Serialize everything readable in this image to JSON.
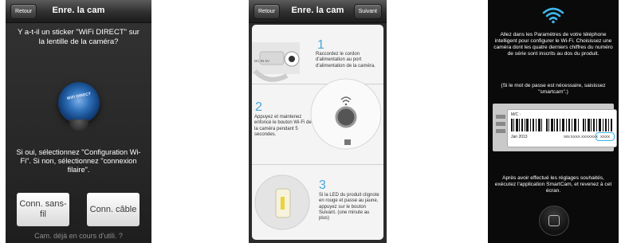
{
  "screen1": {
    "back_label": "Retour",
    "title": "Enre. la cam",
    "question": "Y a-t-il un sticker \"WiFi DIRECT\" sur la lentille de la caméra?",
    "lens_text": "WiFi DIRECT",
    "answer": "Si oui, sélectionnez \"Configuration Wi-Fi\". Si non, sélectionnez \"connexion filaire\".",
    "btn_wifi": "Conn. sans-fil",
    "btn_wired": "Conn. câble",
    "bottom_link": "Cam. déjà en cours d'utili. ?"
  },
  "screen2": {
    "back_label": "Retour",
    "title": "Enre. la cam",
    "next_label": "Suivant",
    "port_label": "DC IN 5V",
    "steps": [
      {
        "num": "1",
        "text": "Raccordez le cordon d'alimentation au port d'alimentation de la caméra."
      },
      {
        "num": "2",
        "text": "Appuyez et maintenez enfoncé le bouton Wi-Fi de la caméra pendant 5 secondes."
      },
      {
        "num": "3",
        "text": "Si la LED du produit clignote en rouge et passe au jaune, appuyez sur le bouton Suivant. (une minute au plus)"
      }
    ]
  },
  "screen3": {
    "instructions": "Allez dans les Paramètres de votre téléphone intelligent pour configurer le Wi-Fi. Choisissez une caméra dont les quatre derniers chiffres du numéro de série sont inscrits au dos du produit.",
    "password_note": "(Si le mot de passe est nécessaire, saisissez \"smartcam\".)",
    "label_mc": "M/C :",
    "label_date": "Jan 2013",
    "label_serial": "S/N:XXXX XXXXXXX",
    "label_serial_highlight": "XXXX",
    "footer": "Après avoir effectué les réglages souhaités, exécutez l'application SmartCam, et revenez à cet écran.",
    "accent_color": "#3fb4e8"
  }
}
